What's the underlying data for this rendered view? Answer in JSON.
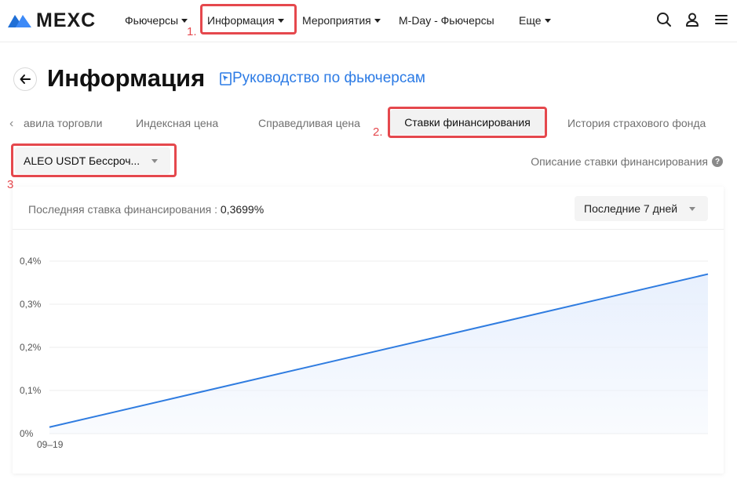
{
  "nav": {
    "logo_text": "MEXC",
    "items": [
      {
        "label": "Фьючерсы",
        "has_caret": true
      },
      {
        "label": "Информация",
        "has_caret": true
      },
      {
        "label": "Мероприятия",
        "has_caret": true
      },
      {
        "label": "M-Day - Фьючерсы",
        "has_caret": false
      },
      {
        "label": "Еще",
        "has_caret": true
      }
    ],
    "right_icons": [
      "search-icon",
      "user-icon",
      "menu-icon"
    ]
  },
  "annotations": {
    "step1": "1.",
    "step2": "2.",
    "step3": "3.",
    "highlight_color": "#e5484d"
  },
  "page": {
    "title": "Информация",
    "guide_link": "Руководство по фьючерсам"
  },
  "tabs": {
    "items": [
      "авила торговли",
      "Индексная цена",
      "Справедливая цена",
      "Ставки финансирования",
      "История страхового фонда"
    ],
    "active": "Ставки финансирования"
  },
  "symbol_select": {
    "value": "ALEO USDT Бессроч..."
  },
  "description_link": "Описание ставки финансирования",
  "card": {
    "last_rate_label": "Последняя ставка финансирования :",
    "last_rate_value": "0,3699%",
    "period": "Последние 7 дней"
  },
  "chart_data": {
    "type": "area",
    "x": [
      "09–19",
      "latest"
    ],
    "x_tick_labels": [
      "09–19"
    ],
    "values": [
      0.015,
      0.3699
    ],
    "y_ticks": [
      "0%",
      "0,1%",
      "0,2%",
      "0,3%",
      "0,4%"
    ],
    "ylim": [
      0,
      0.4
    ],
    "grid": true,
    "line_color": "#2f7ce0",
    "fill_color": "#e8f0fd"
  }
}
